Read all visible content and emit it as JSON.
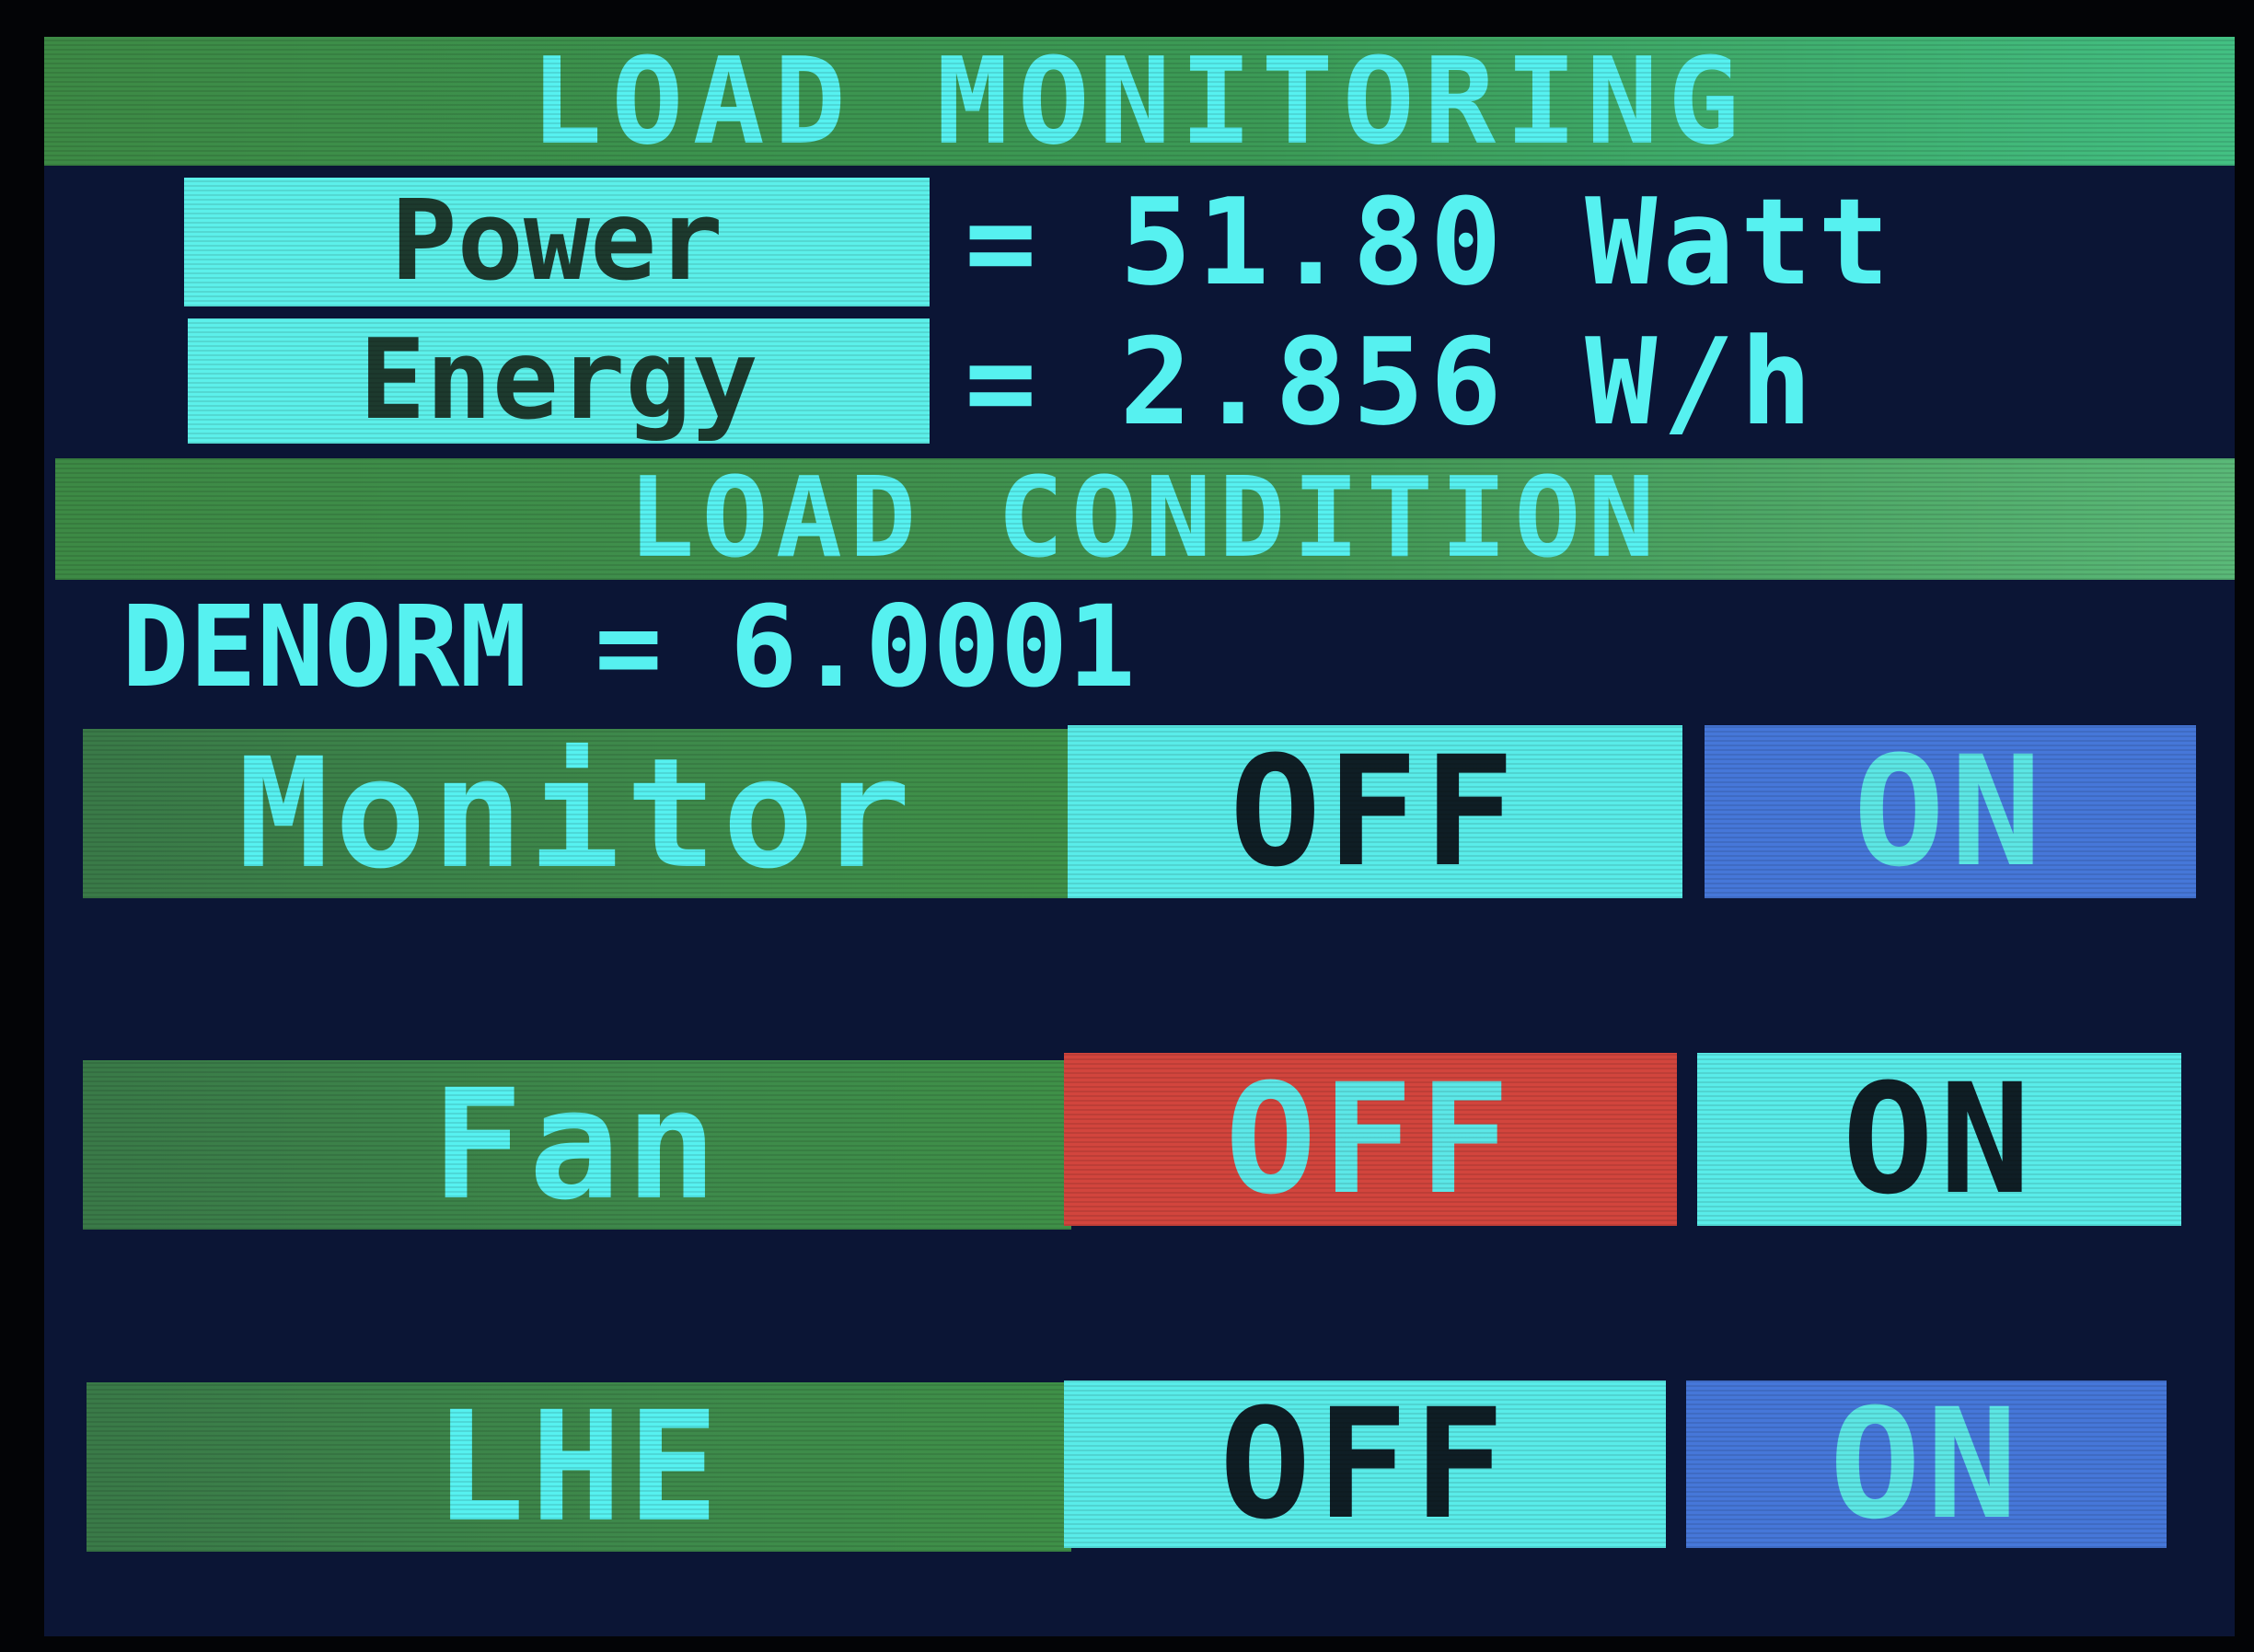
{
  "header": {
    "title": "LOAD MONITORING"
  },
  "measurements": {
    "power_label": "Power",
    "power_value": "= 51.80 Watt",
    "energy_label": "Energy",
    "energy_value": "= 2.856 W/h"
  },
  "condition": {
    "title": "LOAD CONDITION",
    "denorm_text": "DENORM = 6.0001"
  },
  "loads": [
    {
      "name": "Monitor",
      "off_label": "OFF",
      "on_label": "ON",
      "state": "OFF"
    },
    {
      "name": "Fan",
      "off_label": "OFF",
      "on_label": "ON",
      "state": "OFF"
    },
    {
      "name": "LHE",
      "off_label": "OFF",
      "on_label": "ON",
      "state": "OFF"
    }
  ],
  "colors": {
    "text_cyan": "#56f1f0",
    "panel_navy": "#0b1535",
    "bar_green": "#3e8a4b",
    "button_light": "#59ece9",
    "button_blue": "#4677d9",
    "button_red": "#d2453d"
  }
}
